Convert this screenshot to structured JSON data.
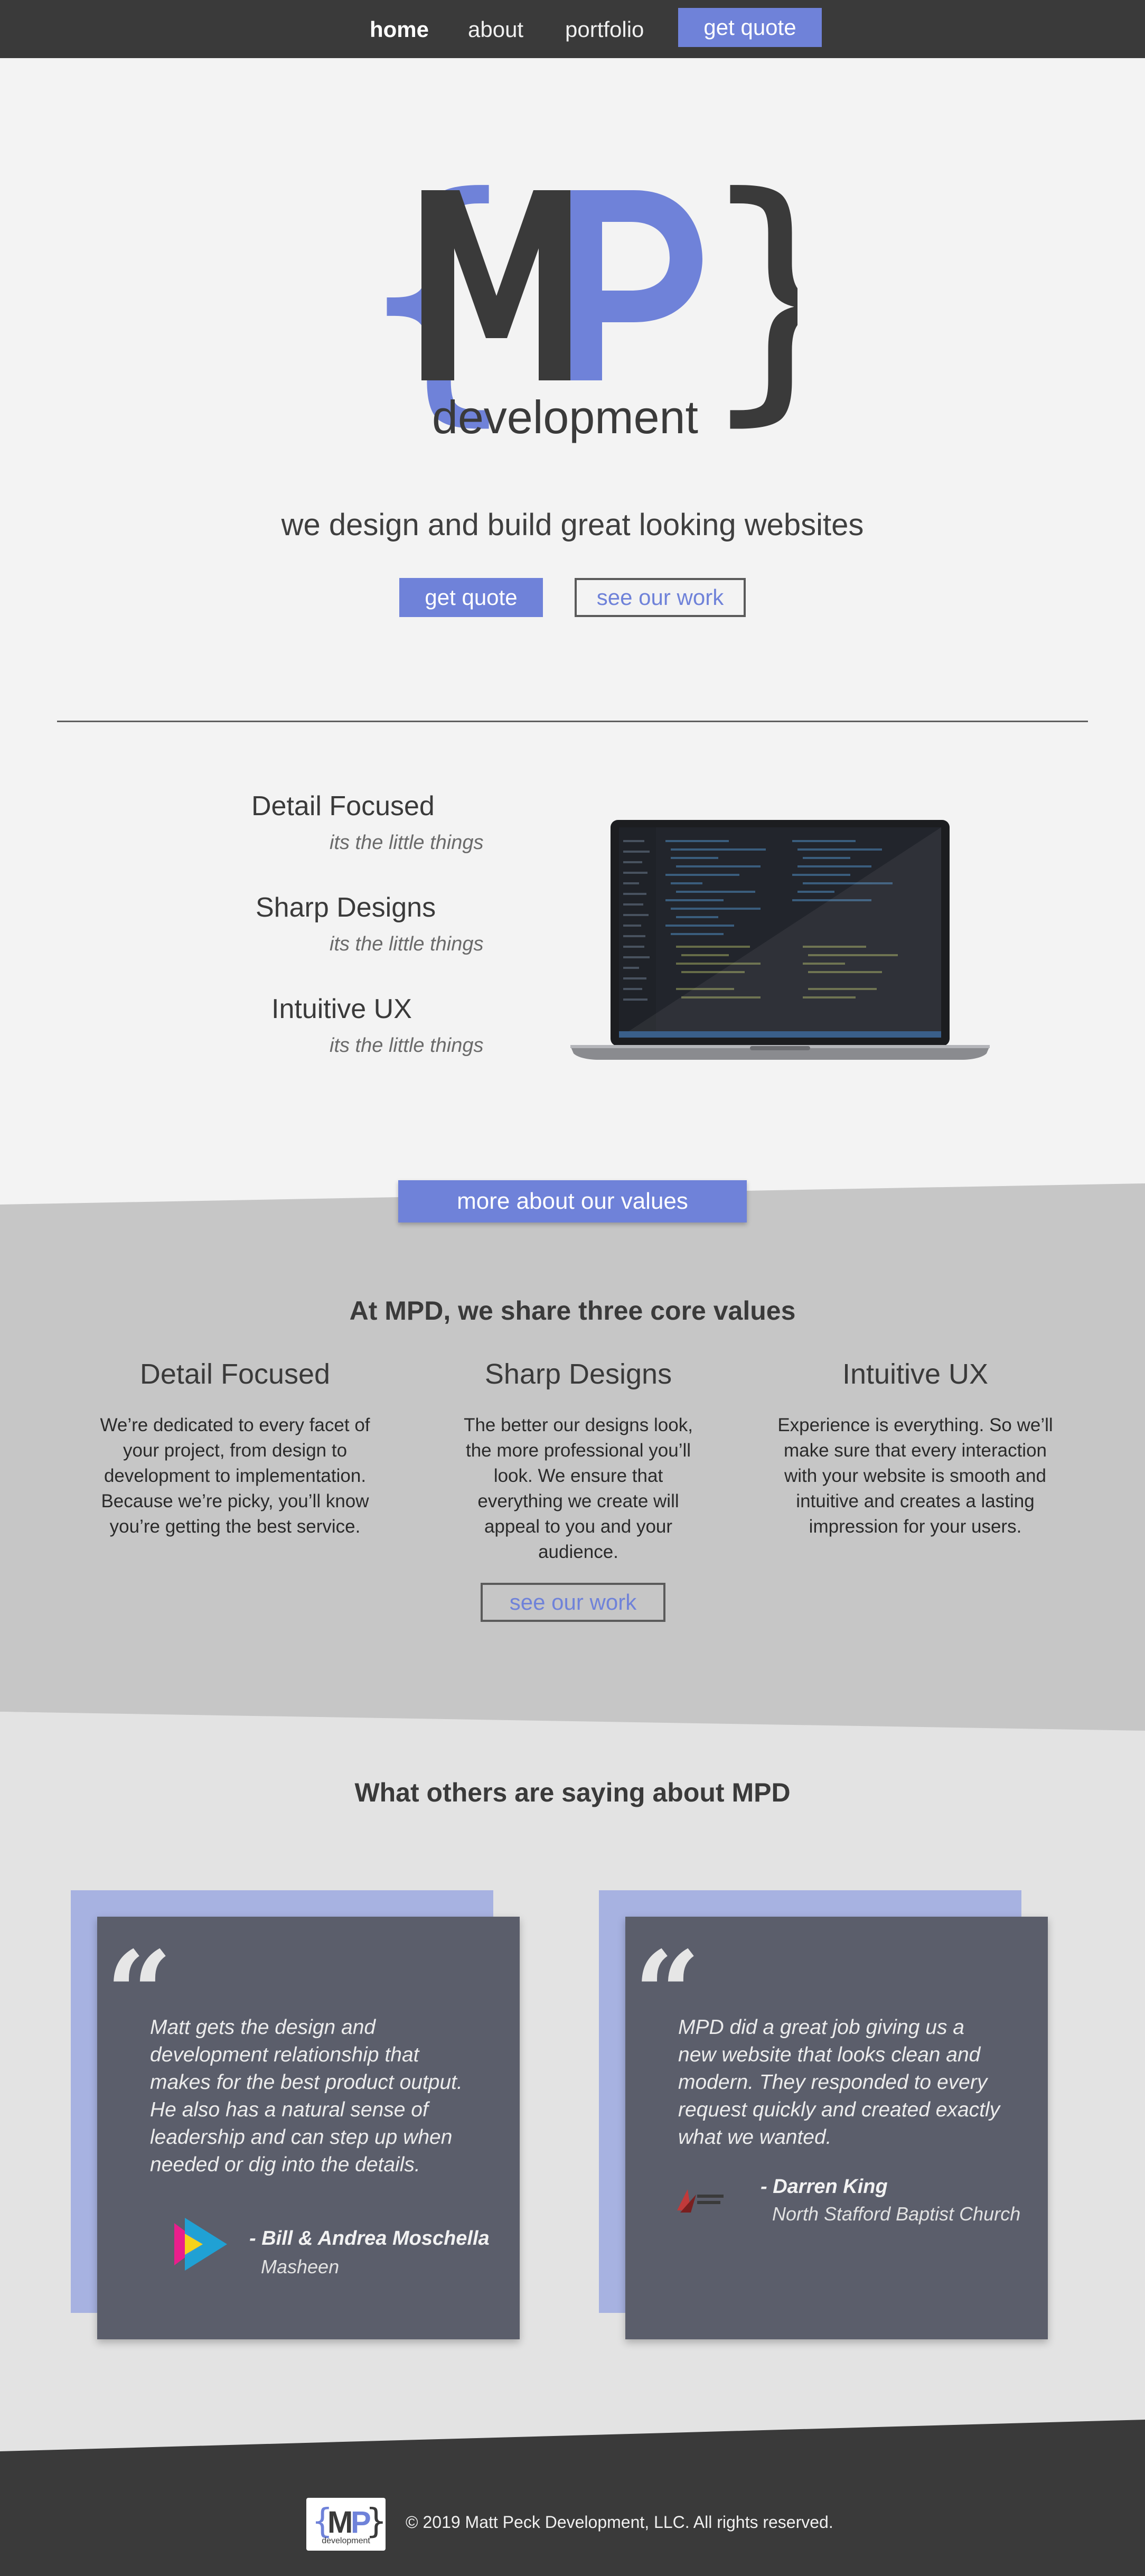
{
  "nav": {
    "items": [
      {
        "label": "home",
        "active": true
      },
      {
        "label": "about",
        "active": false
      },
      {
        "label": "portfolio",
        "active": false
      }
    ],
    "cta_label": "get quote"
  },
  "hero": {
    "logo": {
      "letters_main": "MP",
      "brace_left": "{",
      "brace_right": "}",
      "word": "development"
    },
    "tagline": "we design and build great looking websites",
    "primary_button": "get quote",
    "secondary_button": "see our work"
  },
  "features": {
    "items": [
      {
        "title": "Detail Focused",
        "subtitle": "its the little things"
      },
      {
        "title": "Sharp Designs",
        "subtitle": "its the little things"
      },
      {
        "title": "Intuitive UX",
        "subtitle": "its the little things"
      }
    ],
    "image_icon": "laptop-code-editor-image"
  },
  "values": {
    "button": "more about our values",
    "title": "At MPD, we share three core values",
    "columns": [
      {
        "title": "Detail Focused",
        "text": "We’re dedicated to every facet of your project, from design to development to implementation. Because we’re picky, you’ll know you’re getting the best service."
      },
      {
        "title": "Sharp Designs",
        "text": "The better our designs look, the more professional you’ll look. We ensure that everything we create will appeal to you and your audience."
      },
      {
        "title": "Intuitive UX",
        "text": "Experience is everything. So we’ll make sure that every interaction with your website is smooth and intuitive and creates a lasting impression for your users."
      }
    ],
    "see_work_button": "see our work"
  },
  "testimonials": {
    "title": "What others are saying about MPD",
    "quote_glyph": "“",
    "items": [
      {
        "quote": "Matt gets the design and development relationship that makes for the best product output. He also has a natural sense of leadership and can step up when needed or dig into the details.",
        "author": "- Bill & Andrea Moschella",
        "org": "Masheen",
        "logo_icon": "masheen-play-logo-icon"
      },
      {
        "quote": "MPD did a great job giving us a new website that looks clean and modern. They responded to every request quickly and created exactly what we wanted.",
        "author": "- Darren King",
        "org": "North Stafford Baptist Church",
        "logo_icon": "church-logo-icon"
      }
    ]
  },
  "footer": {
    "copyright": "© 2019 Matt Peck Development, LLC. All rights reserved.",
    "logo_icon": "mp-development-logo-icon"
  },
  "colors": {
    "nav_bg": "#3a3a3a",
    "accent": "#6f82d9",
    "page_bg": "#f3f3f3",
    "values_bg": "#c6c6c6",
    "testimonial_bg": "#e3e3e3",
    "card_bg": "#5b5e6b",
    "card_back": "#a7b2e1",
    "footer_bg": "#3a3a3a"
  }
}
